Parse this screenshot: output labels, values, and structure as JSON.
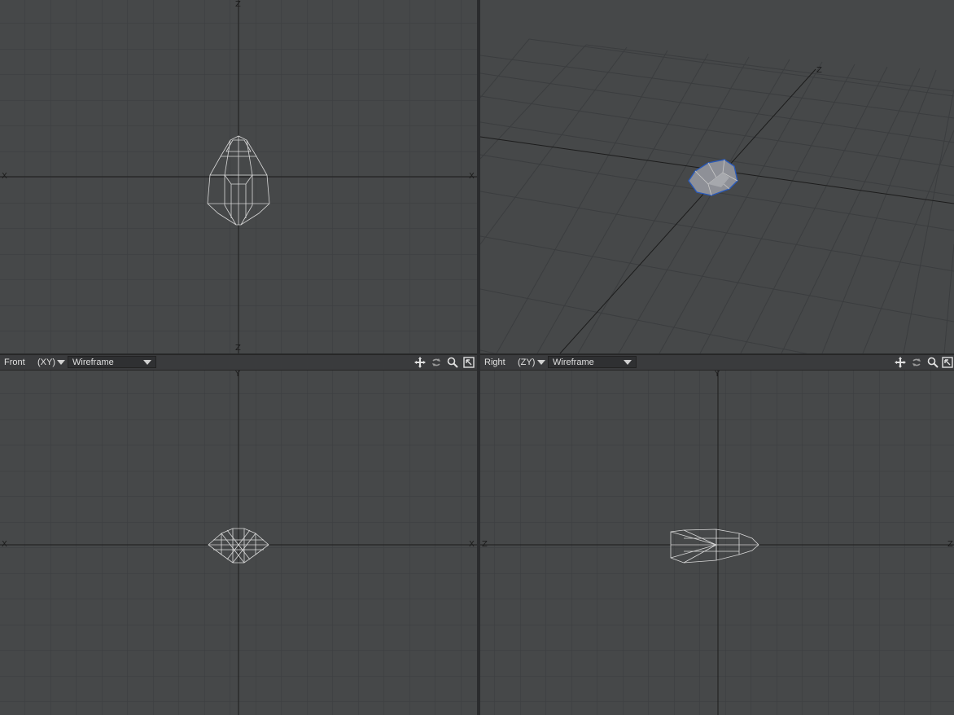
{
  "viewports": {
    "top": {
      "axis_top": "Z",
      "axis_bottom": "Z",
      "axis_left": "X",
      "axis_right": "X"
    },
    "perspective": {
      "axis_label": "Z"
    },
    "front": {
      "name": "Front",
      "axes": "(XY)",
      "mode": "Wireframe",
      "axis_top": "Y",
      "axis_left": "X",
      "axis_right": "X"
    },
    "right": {
      "name": "Right",
      "axes": "(ZY)",
      "mode": "Wireframe",
      "axis_top": "Y",
      "axis_left": "Z",
      "axis_right": "Z"
    }
  },
  "icons": {
    "move": "move-icon",
    "rotate": "rotate-icon",
    "zoom": "magnifier-icon",
    "maximize": "maximize-icon"
  },
  "colors": {
    "viewport_bg": "#464849",
    "grid": "#3b3d3f",
    "axis": "#1c1c1c",
    "wire": "#d8d8d8",
    "selection": "#2a5ab8"
  }
}
